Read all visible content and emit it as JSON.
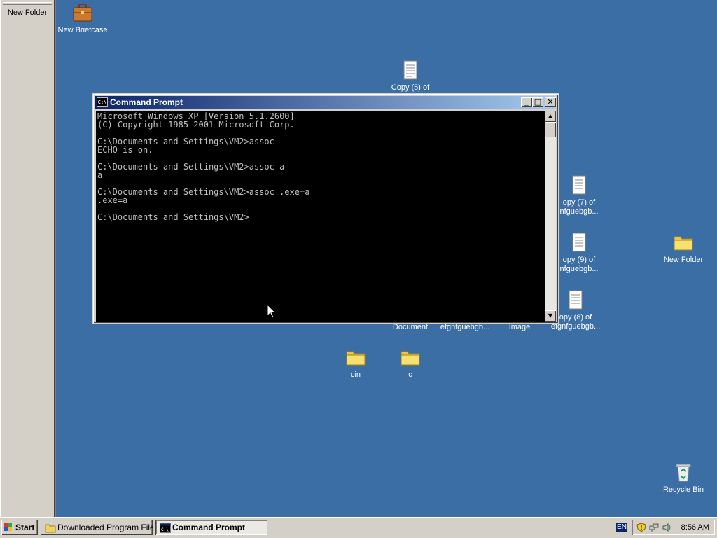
{
  "side_panel": {
    "item_label": "New Folder"
  },
  "desktop_icons": [
    {
      "label": "New Briefcase"
    },
    {
      "label": "Copy (5) of"
    },
    {
      "label": "opy (7) of",
      "label2": "nfguebgb..."
    },
    {
      "label": "opy (9) of",
      "label2": "nfguebgb..."
    },
    {
      "label": "opy (8) of",
      "label2": "efgnfguebgb..."
    },
    {
      "label": "New Folder"
    },
    {
      "label": "Document"
    },
    {
      "label": "efgnfguebgb..."
    },
    {
      "label": "Image"
    },
    {
      "label": "cin"
    },
    {
      "label": "c"
    },
    {
      "label": "Recycle Bin"
    }
  ],
  "window": {
    "title": "Command Prompt",
    "icon_text": "C:\\",
    "minimize_glyph": "_",
    "maximize_glyph": "□",
    "close_glyph": "✕",
    "console_lines": [
      "Microsoft Windows XP [Version 5.1.2600]",
      "(C) Copyright 1985-2001 Microsoft Corp.",
      "",
      "C:\\Documents and Settings\\VM2>assoc",
      "ECHO is on.",
      "",
      "C:\\Documents and Settings\\VM2>assoc a",
      "a",
      "",
      "C:\\Documents and Settings\\VM2>assoc .exe=a",
      ".exe=a",
      "",
      "C:\\Documents and Settings\\VM2>"
    ]
  },
  "taskbar": {
    "start_label": "Start",
    "tasks": [
      {
        "label": "Downloaded Program Files",
        "active": false
      },
      {
        "label": "Command Prompt",
        "active": true
      }
    ],
    "language": "EN",
    "clock": "8:56 AM"
  },
  "colors": {
    "desktop": "#3a6ea5",
    "titlebar_start": "#0a246a",
    "titlebar_end": "#a6caf0",
    "console_bg": "#000000",
    "console_fg": "#c0c0c0"
  }
}
